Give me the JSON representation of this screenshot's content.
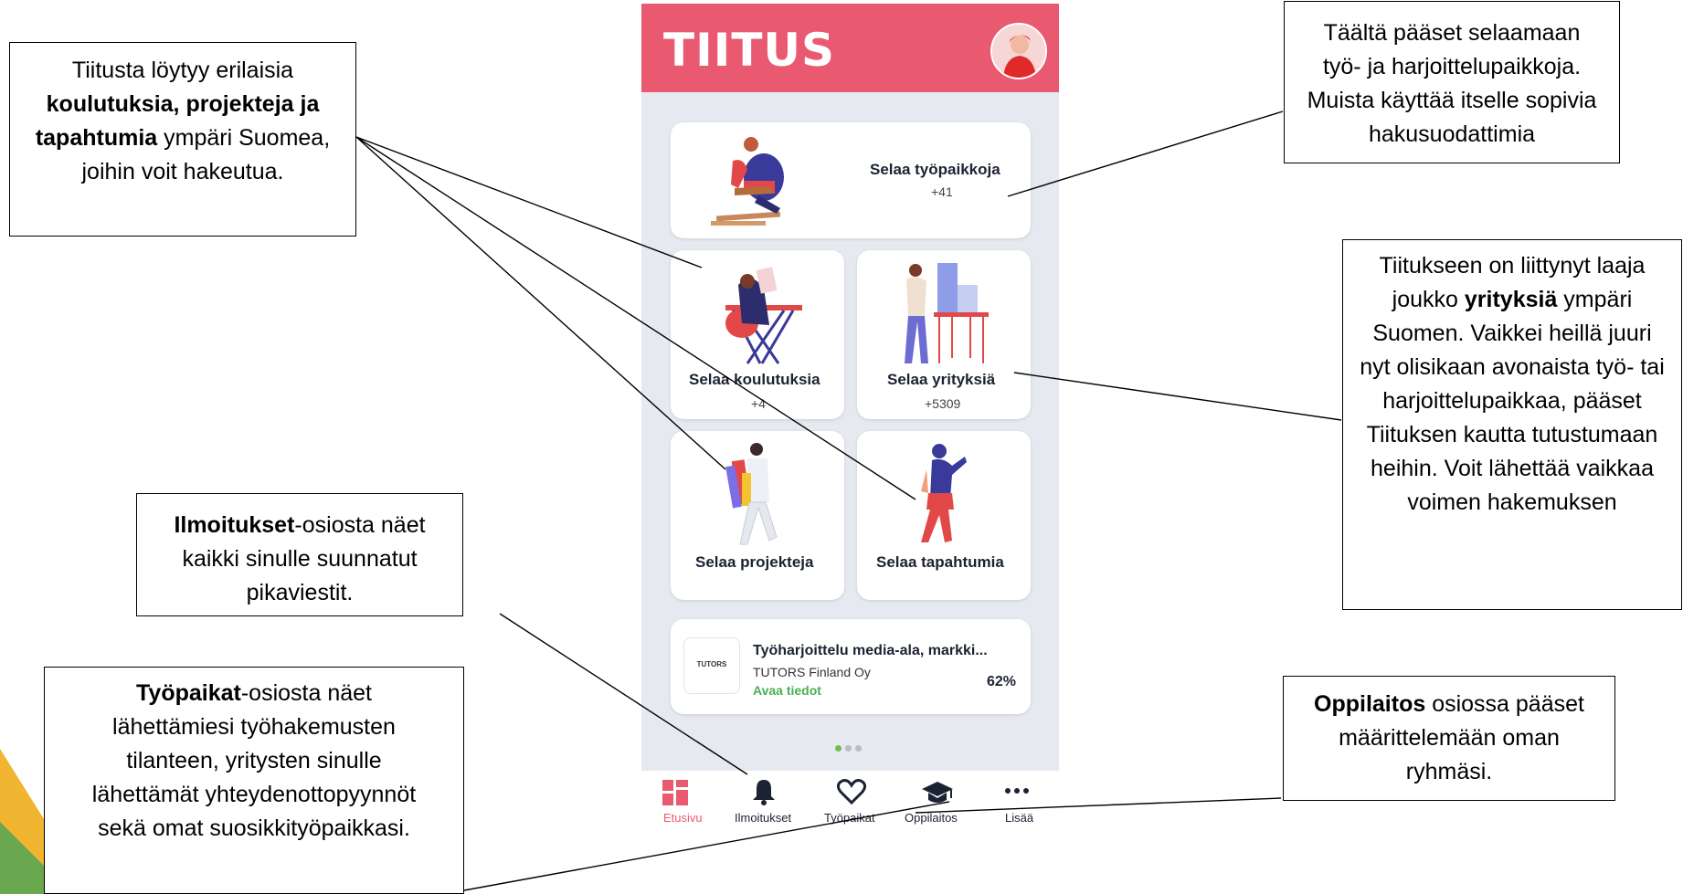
{
  "app": {
    "logo": "TIITUS",
    "colors": {
      "brand": "#e9596f",
      "accent_green": "#4caf50",
      "text_dark": "#1b2232"
    }
  },
  "cards": {
    "jobs": {
      "title": "Selaa työpaikkoja",
      "count": "+41"
    },
    "courses": {
      "title": "Selaa koulutuksia",
      "count": "+4"
    },
    "companies": {
      "title": "Selaa yrityksiä",
      "count": "+5309"
    },
    "projects": {
      "title": "Selaa projekteja"
    },
    "events": {
      "title": "Selaa tapahtumia"
    }
  },
  "offer": {
    "logo_text": "TUTORS",
    "title": "Työharjoittelu media-ala, markki...",
    "company": "TUTORS Finland Oy",
    "link": "Avaa tiedot",
    "percent": "62%"
  },
  "nav": [
    {
      "label": "Etusivu",
      "icon": "grid-icon",
      "active": true
    },
    {
      "label": "Ilmoitukset",
      "icon": "bell-icon"
    },
    {
      "label": "Työpaikat",
      "icon": "heart-icon"
    },
    {
      "label": "Oppilaitos",
      "icon": "graduation-cap-icon"
    },
    {
      "label": "Lisää",
      "icon": "more-icon"
    }
  ],
  "callouts": {
    "topleft": {
      "pre": "Tiitusta löytyy erilaisia ",
      "bold": "koulutuksia, projekteja ja tapahtumia",
      "post": " ympäri Suomea, joihin voit hakeutua."
    },
    "topright": {
      "text": "Täältä pääset selaamaan työ- ja harjoittelupaikkoja. Muista käyttää itselle sopivia hakusuodattimia"
    },
    "right": {
      "pre": "Tiitukseen on liittynyt laaja joukko ",
      "bold": "yrityksiä",
      "post": " ympäri Suomen. Vaikkei heillä juuri nyt olisikaan avonaista työ- tai harjoittelupaikkaa, pääset Tiituksen kautta tutustumaan heihin. Voit lähettää vaikkaa voimen hakemuksen"
    },
    "ilmoitukset": {
      "bold": "Ilmoitukset",
      "post": "-osiosta näet kaikki sinulle suunnatut pikaviestit."
    },
    "tyopaikat": {
      "bold": "Työpaikat",
      "post": "-osiosta näet lähettämiesi työhakemusten tilanteen, yritysten sinulle lähettämät yhteydenottopyynnöt sekä omat suosikkityöpaikkasi."
    },
    "oppilaitos": {
      "bold": "Oppilaitos",
      "post": " osiossa pääset määrittelemään oman ryhmäsi."
    }
  }
}
